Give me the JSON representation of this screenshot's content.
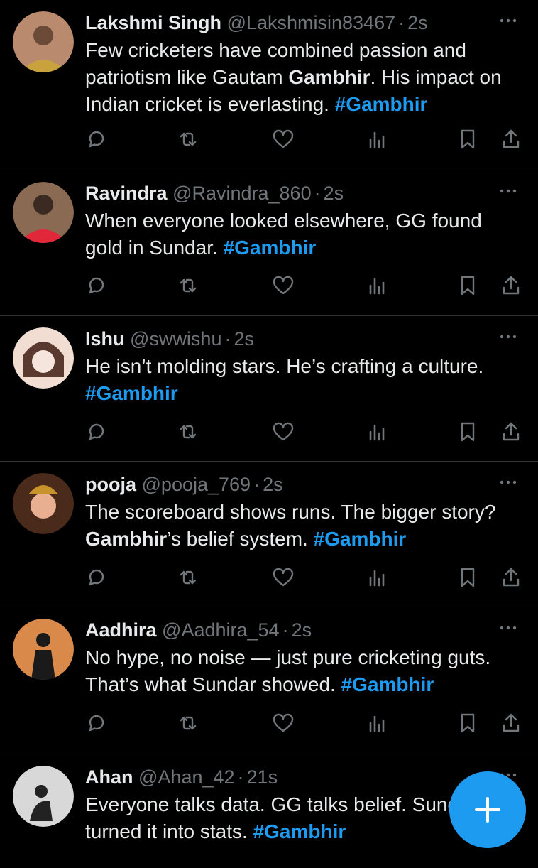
{
  "accent_color": "#1d9bf0",
  "tweets": [
    {
      "name": "Lakshmi Singh",
      "handle": "@Lakshmisin83467",
      "sep": "·",
      "time": "2s",
      "parts": [
        {
          "t": "Few cricketers have combined passion and patriotism like Gautam ",
          "s": "n"
        },
        {
          "t": "Gambhir",
          "s": "b"
        },
        {
          "t": ". His impact on Indian cricket is everlasting. ",
          "s": "n"
        },
        {
          "t": "#Gambhir",
          "s": "h"
        }
      ]
    },
    {
      "name": "Ravindra",
      "handle": "@Ravindra_860",
      "sep": "·",
      "time": "2s",
      "parts": [
        {
          "t": "When everyone looked elsewhere, GG found gold in Sundar. ",
          "s": "n"
        },
        {
          "t": "#Gambhir",
          "s": "h"
        }
      ]
    },
    {
      "name": "Ishu",
      "handle": "@swwishu",
      "sep": "·",
      "time": "2s",
      "parts": [
        {
          "t": "He isn’t molding stars. He’s crafting a culture. ",
          "s": "n"
        },
        {
          "t": "#Gambhir",
          "s": "h"
        }
      ]
    },
    {
      "name": "pooja",
      "handle": "@pooja_769",
      "sep": "·",
      "time": "2s",
      "parts": [
        {
          "t": "The scoreboard shows runs. The bigger story? ",
          "s": "n"
        },
        {
          "t": "Gambhir",
          "s": "b"
        },
        {
          "t": "’s belief system. ",
          "s": "n"
        },
        {
          "t": "#Gambhir",
          "s": "h"
        }
      ]
    },
    {
      "name": "Aadhira",
      "handle": "@Aadhira_54",
      "sep": "·",
      "time": "2s",
      "parts": [
        {
          "t": "No hype, no noise — just pure cricketing guts. That’s what Sundar showed. ",
          "s": "n"
        },
        {
          "t": "#Gambhir",
          "s": "h"
        }
      ]
    },
    {
      "name": "Ahan",
      "handle": "@Ahan_42",
      "sep": "·",
      "time": "21s",
      "parts": [
        {
          "t": "Everyone talks data. GG talks belief. Sundar just turned it into stats. ",
          "s": "n"
        },
        {
          "t": "#Gambhir",
          "s": "h"
        }
      ]
    }
  ],
  "icons": {
    "more": "more-dots-icon",
    "reply": "reply-icon",
    "retweet": "retweet-icon",
    "like": "heart-icon",
    "views": "views-icon",
    "bookmark": "bookmark-icon",
    "share": "share-icon",
    "compose": "plus-icon"
  }
}
